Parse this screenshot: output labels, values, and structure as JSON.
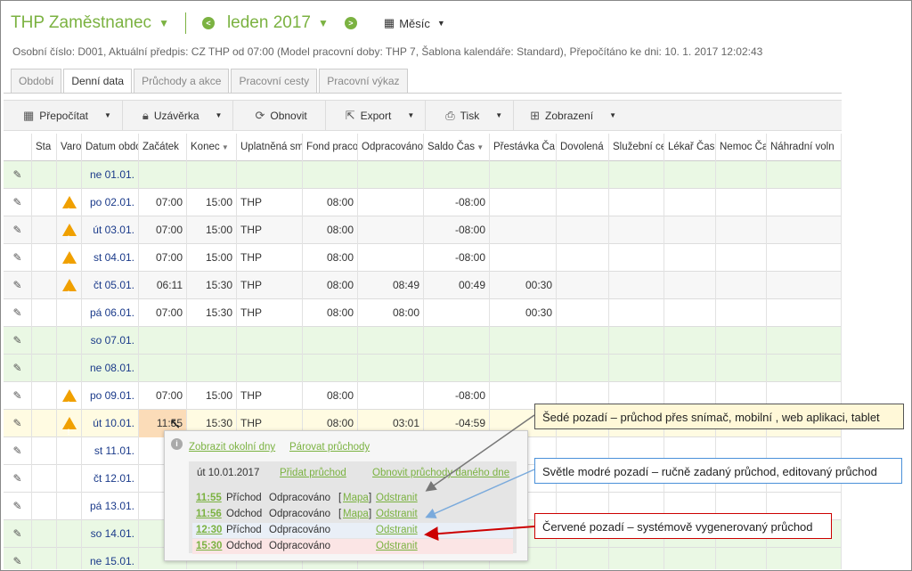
{
  "header": {
    "title": "THP Zaměstnanec",
    "month": "leden 2017",
    "period": "Měsíc",
    "info": "Osobní číslo: D001, Aktuální předpis: CZ THP od 07:00 (Model pracovní doby: THP 7, Šablona kalendáře: Standard), Přepočítáno ke dni: 10. 1. 2017 12:02:43"
  },
  "tabs": [
    "Období",
    "Denní data",
    "Průchody a akce",
    "Pracovní cesty",
    "Pracovní výkaz"
  ],
  "active_tab": "Denní data",
  "toolbar": {
    "recalc": "Přepočítat",
    "lock": "Uzávěrka",
    "refresh": "Obnovit",
    "export": "Export",
    "print": "Tisk",
    "view": "Zobrazení"
  },
  "columns": [
    "Sta",
    "Varo",
    "Datum obdo",
    "Začátek",
    "Konec",
    "Uplatněná sm",
    "Fond praco",
    "Odpracováno",
    "Saldo Čas",
    "Přestávka Ča",
    "Dovolená",
    "Služební ce",
    "Lékař Čas",
    "Nemoc Ča",
    "Náhradní voln"
  ],
  "rows": [
    {
      "date": "ne 01.01.",
      "warn": false,
      "start": "",
      "end": "",
      "shift": "",
      "fund": "",
      "worked": "",
      "saldo": "",
      "break": "",
      "bg": "green"
    },
    {
      "date": "po 02.01.",
      "warn": true,
      "start": "07:00",
      "end": "15:00",
      "shift": "THP",
      "fund": "08:00",
      "worked": "",
      "saldo": "-08:00",
      "break": "",
      "bg": "white"
    },
    {
      "date": "út 03.01.",
      "warn": true,
      "start": "07:00",
      "end": "15:00",
      "shift": "THP",
      "fund": "08:00",
      "worked": "",
      "saldo": "-08:00",
      "break": "",
      "bg": "gray"
    },
    {
      "date": "st 04.01.",
      "warn": true,
      "start": "07:00",
      "end": "15:00",
      "shift": "THP",
      "fund": "08:00",
      "worked": "",
      "saldo": "-08:00",
      "break": "",
      "bg": "white"
    },
    {
      "date": "čt 05.01.",
      "warn": true,
      "start": "06:11",
      "end": "15:30",
      "shift": "THP",
      "fund": "08:00",
      "worked": "08:49",
      "saldo": "00:49",
      "break": "00:30",
      "bg": "gray"
    },
    {
      "date": "pá 06.01.",
      "warn": false,
      "start": "07:00",
      "end": "15:30",
      "shift": "THP",
      "fund": "08:00",
      "worked": "08:00",
      "saldo": "",
      "break": "00:30",
      "bg": "white"
    },
    {
      "date": "so 07.01.",
      "warn": false,
      "start": "",
      "end": "",
      "shift": "",
      "fund": "",
      "worked": "",
      "saldo": "",
      "break": "",
      "bg": "green"
    },
    {
      "date": "ne 08.01.",
      "warn": false,
      "start": "",
      "end": "",
      "shift": "",
      "fund": "",
      "worked": "",
      "saldo": "",
      "break": "",
      "bg": "green"
    },
    {
      "date": "po 09.01.",
      "warn": true,
      "start": "07:00",
      "end": "15:00",
      "shift": "THP",
      "fund": "08:00",
      "worked": "",
      "saldo": "-08:00",
      "break": "",
      "bg": "white"
    },
    {
      "date": "út 10.01.",
      "warn": true,
      "start": "11:55",
      "end": "15:30",
      "shift": "THP",
      "fund": "08:00",
      "worked": "03:01",
      "saldo": "-04:59",
      "break": "",
      "bg": "yellow"
    },
    {
      "date": "st 11.01.",
      "warn": false,
      "start": "",
      "end": "",
      "shift": "",
      "fund": "",
      "worked": "",
      "saldo": "",
      "break": "",
      "bg": "white"
    },
    {
      "date": "čt 12.01.",
      "warn": false,
      "start": "",
      "end": "",
      "shift": "",
      "fund": "",
      "worked": "",
      "saldo": "",
      "break": "",
      "bg": "white"
    },
    {
      "date": "pá 13.01.",
      "warn": false,
      "start": "",
      "end": "",
      "shift": "",
      "fund": "",
      "worked": "",
      "saldo": "",
      "break": "",
      "bg": "white"
    },
    {
      "date": "so 14.01.",
      "warn": false,
      "start": "",
      "end": "",
      "shift": "",
      "fund": "",
      "worked": "",
      "saldo": "",
      "break": "",
      "bg": "green"
    },
    {
      "date": "ne 15.01.",
      "warn": false,
      "start": "",
      "end": "",
      "shift": "",
      "fund": "",
      "worked": "",
      "saldo": "",
      "break": "",
      "bg": "green"
    }
  ],
  "popup": {
    "show_days": "Zobrazit okolní dny",
    "pair": "Párovat průchody",
    "date": "út 10.01.2017",
    "add": "Přidat průchod",
    "restore": "Obnovit průchody daného dne",
    "passes": [
      {
        "time": "11:55",
        "type": "Příchod",
        "status": "Odpracováno",
        "map": "Mapa",
        "remove": "Odstranit",
        "bg": "pr-gray"
      },
      {
        "time": "11:56",
        "type": "Odchod",
        "status": "Odpracováno",
        "map": "Mapa",
        "remove": "Odstranit",
        "bg": "pr-gray"
      },
      {
        "time": "12:30",
        "type": "Příchod",
        "status": "Odpracováno",
        "map": "",
        "remove": "Odstranit",
        "bg": "pr-blue"
      },
      {
        "time": "15:30",
        "type": "Odchod",
        "status": "Odpracováno",
        "map": "",
        "remove": "Odstranit",
        "bg": "pr-red"
      }
    ]
  },
  "callouts": {
    "gray": "Šedé pozadí – průchod přes snímač, mobilní , web aplikaci, tablet",
    "blue": "Světle modré pozadí – ručně zadaný průchod, editovaný průchod",
    "red": "Červené pozadí – systémově vygenerovaný průchod"
  },
  "colors": {
    "accent": "#7bb241",
    "warning": "#f0a000",
    "weekend": "#eaf8e4",
    "callout_gray": "#fff8d8",
    "callout_blue": "#4a90d9",
    "callout_red": "#cc0000"
  }
}
